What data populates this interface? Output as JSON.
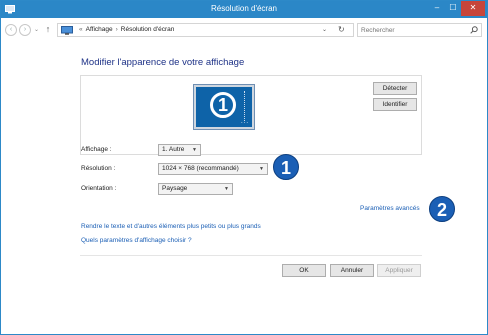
{
  "window": {
    "title": "Résolution d'écran",
    "controls": {
      "minimize": "–",
      "maximize": "☐",
      "close": "✕"
    }
  },
  "addressbar": {
    "breadcrumbs": [
      "«",
      "Affichage",
      "›",
      "Résolution d'écran"
    ],
    "nav": {
      "back": "‹",
      "forward": "›",
      "down": "⌄",
      "up": "↑"
    },
    "dropdown": "⌄",
    "refresh": "↻"
  },
  "search": {
    "placeholder": "Rechercher"
  },
  "main": {
    "heading": "Modifier l'apparence de votre affichage",
    "monitor": {
      "number": "1",
      "dots": "..."
    },
    "buttons": {
      "detect": "Détecter",
      "identify": "Identifier"
    },
    "fields": {
      "display": {
        "label": "Affichage :",
        "value": "1. Autre"
      },
      "resolution": {
        "label": "Résolution :",
        "value": "1024 × 768 (recommandé)"
      },
      "orientation": {
        "label": "Orientation :",
        "value": "Paysage"
      }
    },
    "links": {
      "advanced": "Paramètres avancés",
      "text_size": "Rendre le texte et d'autres éléments plus petits ou plus grands",
      "choose": "Quels paramètres d'affichage choisir ?"
    },
    "dialog_buttons": {
      "ok": "OK",
      "cancel": "Annuler",
      "apply": "Appliquer"
    }
  },
  "callouts": {
    "first": "1",
    "second": "2"
  },
  "colors": {
    "titlebar": "#2b87c7",
    "close": "#c7453a",
    "link": "#1b5fb5",
    "heading": "#1e3287",
    "monitor": "#0e63a8",
    "badge": "#1b5fb5"
  }
}
